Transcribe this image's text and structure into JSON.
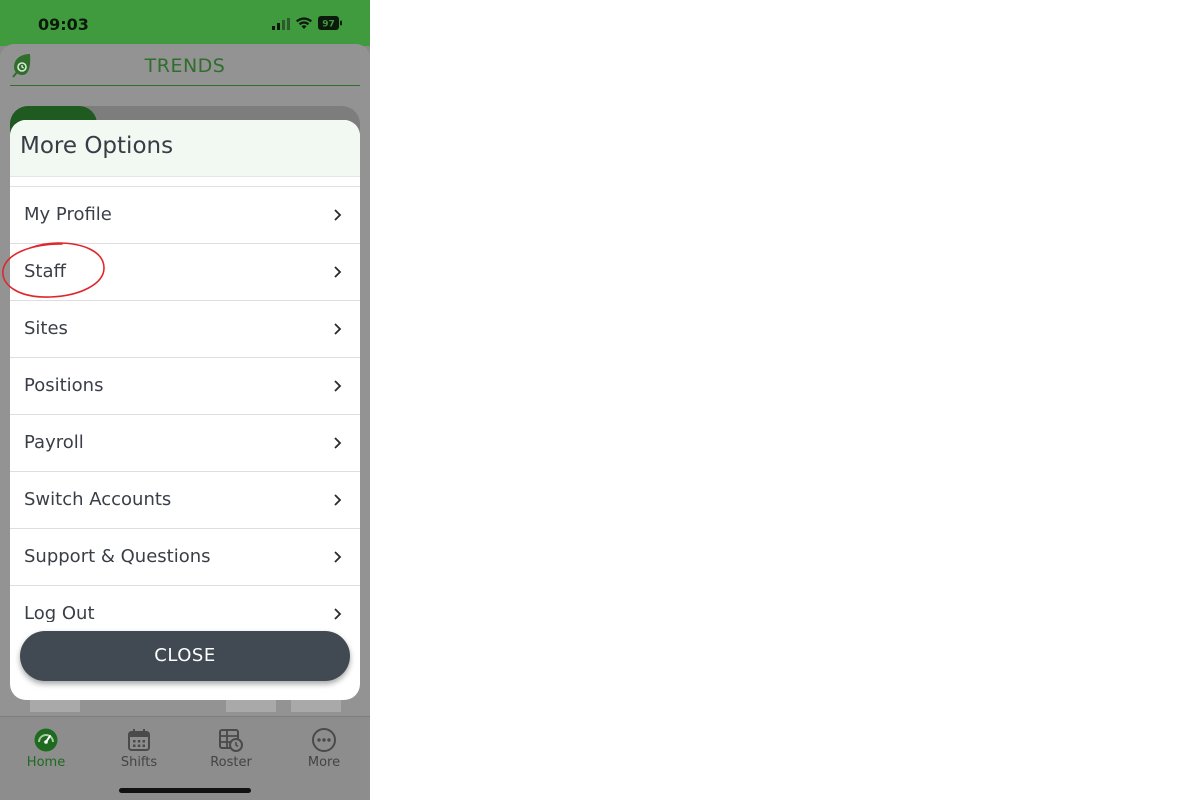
{
  "status_bar": {
    "time": "09:03",
    "battery": "97"
  },
  "app": {
    "title": "TRENDS"
  },
  "modal": {
    "title": "More Options",
    "items": [
      {
        "label": "My Profile"
      },
      {
        "label": "Staff"
      },
      {
        "label": "Sites"
      },
      {
        "label": "Positions"
      },
      {
        "label": "Payroll"
      },
      {
        "label": "Switch Accounts"
      },
      {
        "label": "Support & Questions"
      },
      {
        "label": "Log Out"
      }
    ],
    "close_label": "CLOSE"
  },
  "tab_bar": {
    "items": [
      {
        "label": "Home",
        "icon": "speedometer-icon",
        "active": true
      },
      {
        "label": "Shifts",
        "icon": "calendar-icon"
      },
      {
        "label": "Roster",
        "icon": "roster-clock-icon"
      },
      {
        "label": "More",
        "icon": "more-dots-icon"
      }
    ]
  },
  "colors": {
    "brand_green": "#3f9b3e",
    "title_green": "#2f6e2b",
    "close_button": "#414a52",
    "annotation_red": "#e0262b"
  }
}
